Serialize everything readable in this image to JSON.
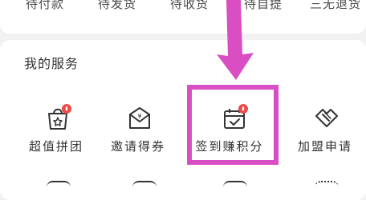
{
  "orders": {
    "tabs": [
      {
        "label": "待付款"
      },
      {
        "label": "待发货"
      },
      {
        "label": "待收货"
      },
      {
        "label": "待自提"
      },
      {
        "label": "三无退货"
      }
    ]
  },
  "services": {
    "title": "我的服务",
    "items": [
      {
        "label": "超值拼团",
        "icon": "shopping-bag-icon"
      },
      {
        "label": "邀请得券",
        "icon": "coupon-envelope-icon"
      },
      {
        "label": "签到赚积分",
        "icon": "calendar-check-icon"
      },
      {
        "label": "加盟申请",
        "icon": "handshake-icon"
      }
    ]
  },
  "colors": {
    "badge": "#f04848",
    "highlight": "#d94ec2",
    "text": "#333333"
  }
}
